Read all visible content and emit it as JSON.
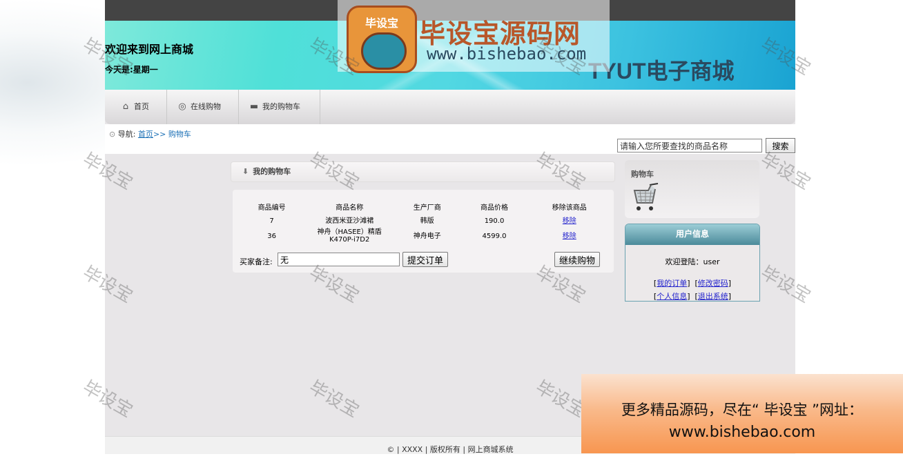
{
  "header": {
    "welcome": "欢迎来到网上商城",
    "today": "今天是:星期一",
    "shop_name": "TYUT电子商城"
  },
  "nav": {
    "items": [
      {
        "label": "首页",
        "icon": "home-icon"
      },
      {
        "label": "在线购物",
        "icon": "globe-icon"
      },
      {
        "label": "我的购物车",
        "icon": "car-icon"
      }
    ]
  },
  "breadcrumb": {
    "prefix": "导航:",
    "home": "首页",
    "sep": ">>",
    "current": "购物车"
  },
  "search": {
    "placeholder": "请输入您所要查找的商品名称",
    "button": "搜索"
  },
  "cart": {
    "title": "我的购物车",
    "columns": [
      "商品编号",
      "商品名称",
      "生产厂商",
      "商品价格",
      "移除该商品"
    ],
    "rows": [
      {
        "id": "7",
        "name": "波西米亚沙滩裙",
        "maker": "韩版",
        "price": "190.0",
        "action": "移除"
      },
      {
        "id": "36",
        "name": "神舟（HASEE）精盾 K470P-i7D2",
        "maker": "神舟电子",
        "price": "4599.0",
        "action": "移除"
      }
    ],
    "remark_label": "买家备注:",
    "remark_value": "无",
    "submit_button": "提交订单",
    "continue_button": "继续购物"
  },
  "sidebar": {
    "cart_title": "购物车",
    "user_title": "用户信息",
    "greeting": "欢迎登陆：user",
    "links": [
      "我的订单",
      "修改密码",
      "个人信息",
      "退出系统"
    ]
  },
  "footer": {
    "text": "© | XXXX | 版权所有 | 网上商城系统"
  },
  "overlay": {
    "logo_text": "毕设宝",
    "brand_name": "毕设宝源码网",
    "brand_url": "www.bishebao.com",
    "watermark": "毕设宝",
    "promo_line1": "更多精品源码，尽在“ 毕设宝 ”网址：",
    "promo_line2": "www.bishebao.com"
  }
}
